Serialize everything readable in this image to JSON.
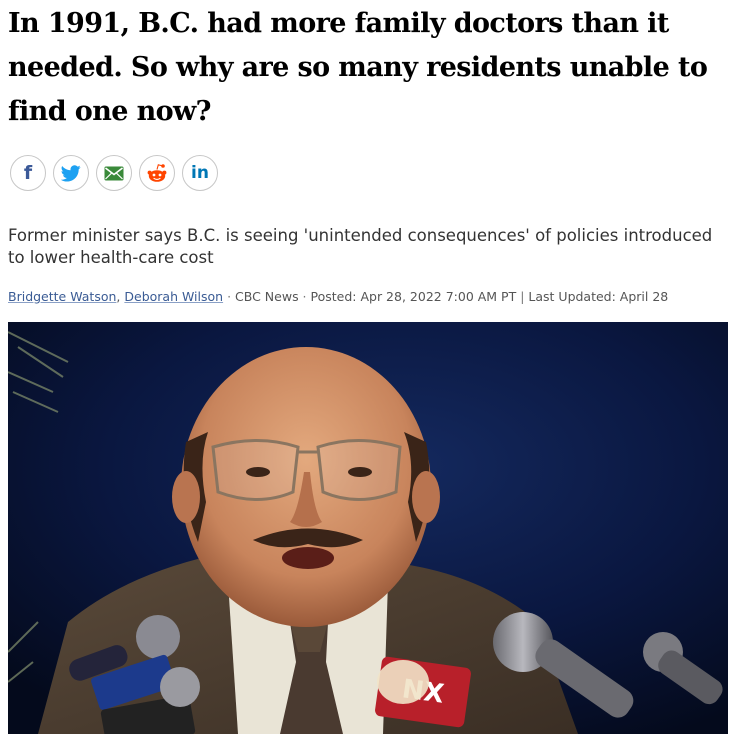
{
  "article": {
    "headline": "In 1991, B.C. had more family doctors than it needed. So why are so many residents unable to find one now?",
    "deck": "Former minister says B.C. is seeing 'unintended consequences' of policies introduced to lower health-care cost",
    "byline": {
      "authors": [
        "Bridgette Watson",
        "Deborah Wilson"
      ],
      "author_separator": ", ",
      "dot": " · ",
      "source": "CBC News",
      "posted_label": "Posted: Apr 28, 2022 7:00 AM PT",
      "divider": " | ",
      "updated_label": "Last Updated: April 28"
    }
  },
  "share": {
    "buttons": [
      {
        "network": "facebook",
        "icon": "facebook-icon",
        "glyph": "f",
        "color": "#3b5998"
      },
      {
        "network": "twitter",
        "icon": "twitter-icon",
        "color": "#1da1f2"
      },
      {
        "network": "email",
        "icon": "email-icon",
        "color": "#3a8a3a"
      },
      {
        "network": "reddit",
        "icon": "reddit-icon",
        "color": "#ff4500"
      },
      {
        "network": "linkedin",
        "icon": "linkedin-icon",
        "glyph": "in",
        "color": "#0077b5"
      }
    ]
  },
  "photo": {
    "mic_flag_text": "NX"
  }
}
